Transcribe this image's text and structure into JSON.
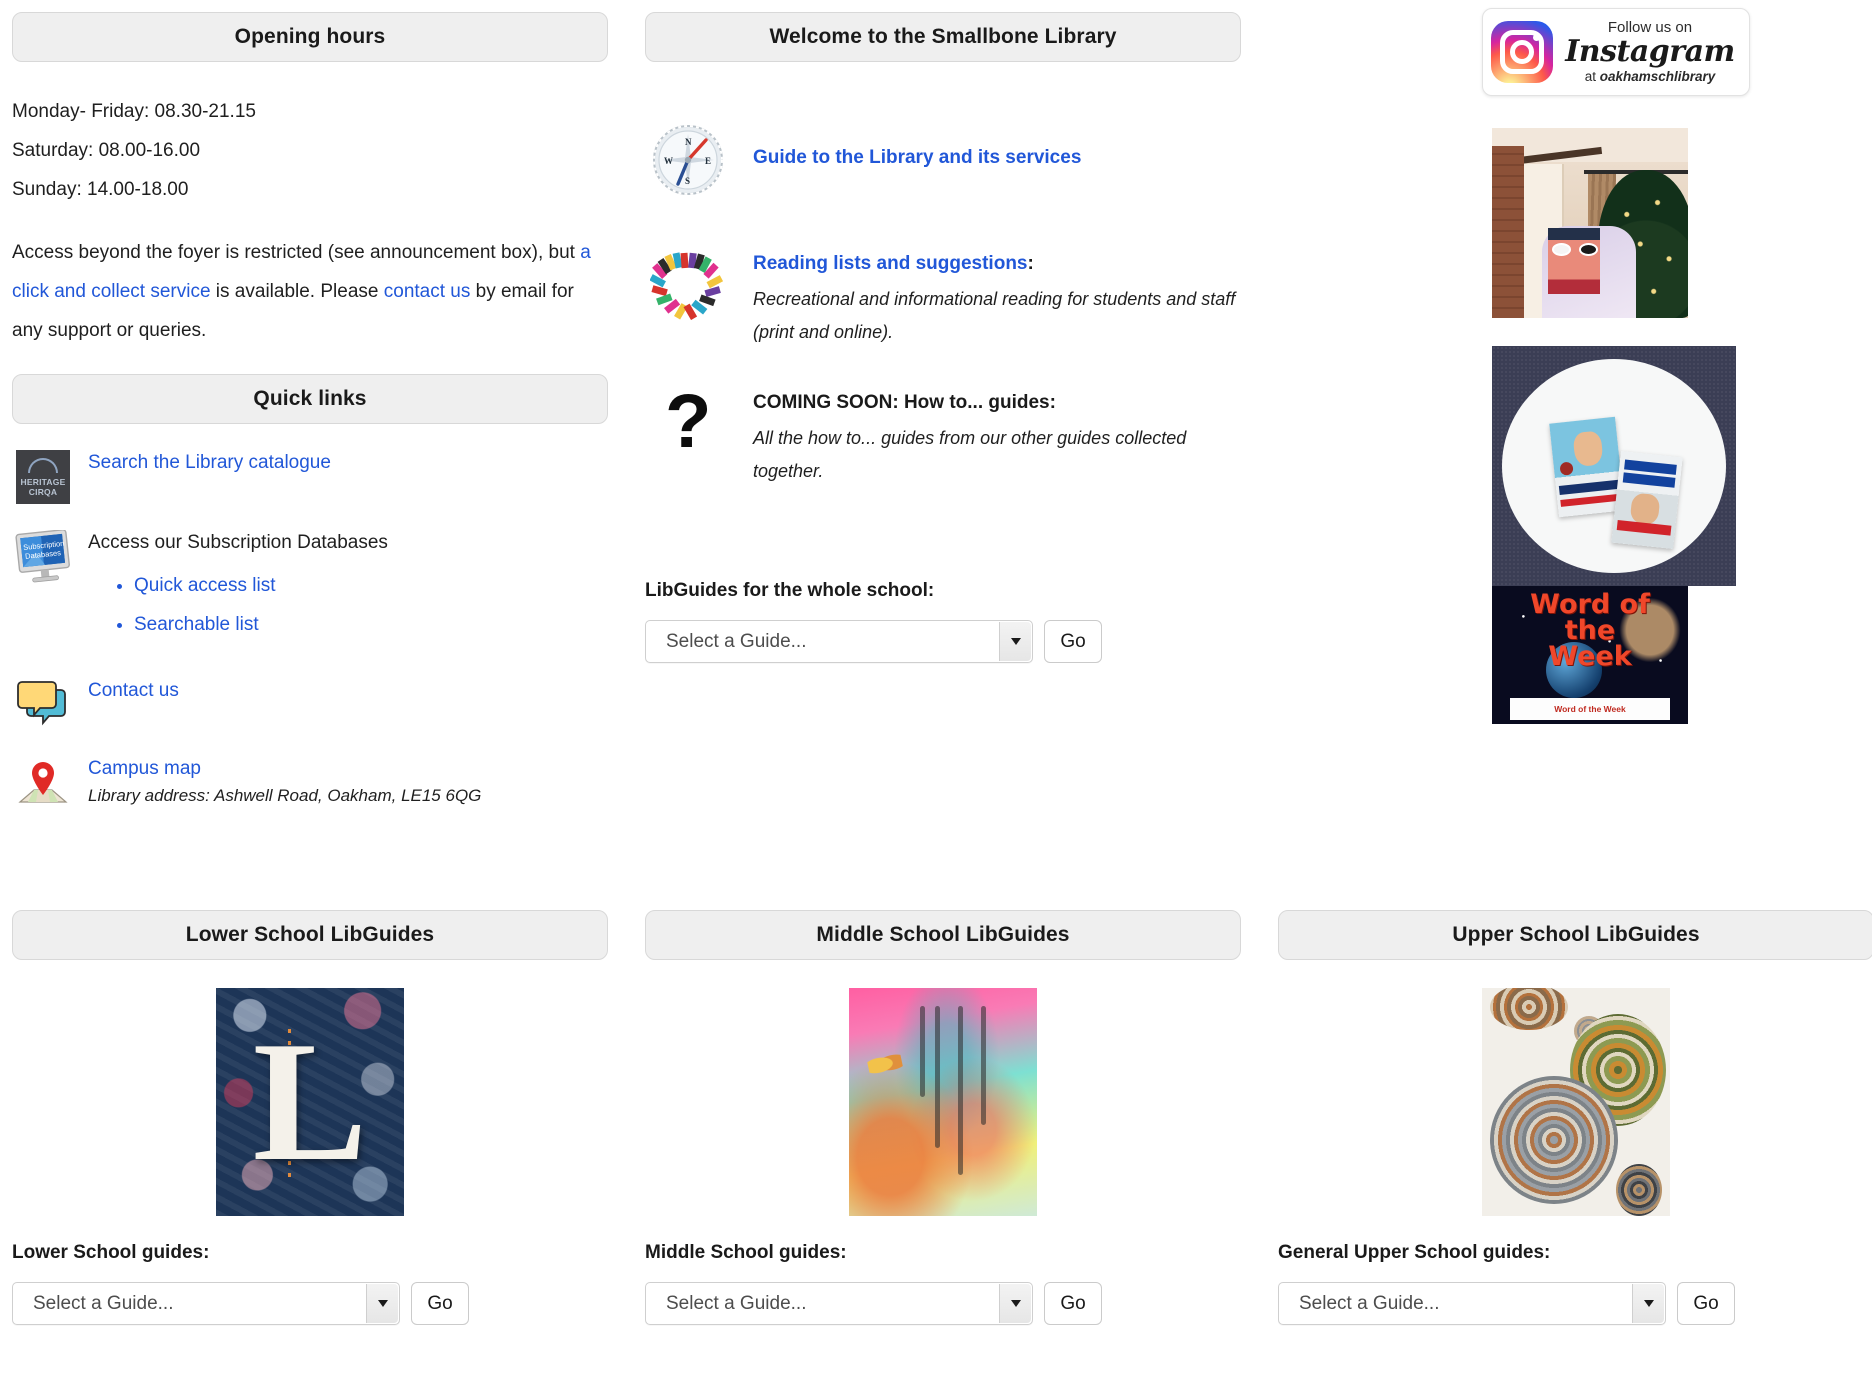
{
  "left": {
    "opening_hours_header": "Opening hours",
    "hours": [
      "Monday- Friday: 08.30-21.15",
      "Saturday:  08.00-16.00",
      "Sunday:  14.00-18.00"
    ],
    "access_text_1": "Access beyond the foyer is restricted (see announcement box), but ",
    "access_link_1": "a click and collect service",
    "access_text_2": " is available. Please ",
    "access_link_2": "contact us",
    "access_text_3": " by email for any support or queries.",
    "quick_links_header": "Quick links",
    "catalogue_link": "Search the Library catalogue",
    "heritage_logo_line1": "HERITAGE",
    "heritage_logo_line2": "CIRQA",
    "databases_label": "Access our Subscription Databases",
    "databases_icon_line1": "Subscription",
    "databases_icon_line2": "Databases",
    "database_sublinks": [
      "Quick access list",
      "Searchable list"
    ],
    "contact_link": "Contact us",
    "campus_map_link": "Campus map",
    "library_address": "Library address: Ashwell Road, Oakham, LE15 6QG"
  },
  "middle": {
    "welcome_header": "Welcome to the Smallbone Library",
    "features": [
      {
        "icon": "compass-icon",
        "title": "Guide to the Library and its services",
        "title_is_link": true,
        "colon": "",
        "desc": ""
      },
      {
        "icon": "book-heart-icon",
        "title": "Reading lists and suggestions",
        "title_is_link": true,
        "colon": ":",
        "desc": "Recreational and informational reading for students and staff (print and online)."
      },
      {
        "icon": "question-mark-icon",
        "title": "COMING SOON: How to... guides:",
        "title_is_link": false,
        "colon": "",
        "desc": "All the how to... guides from our other guides collected together."
      }
    ],
    "select_label": "LibGuides for the whole school:",
    "select_value": "Select a Guide...",
    "go_label": "Go"
  },
  "right": {
    "instagram": {
      "follow_text": "Follow us on",
      "brand": "Instagram",
      "handle_prefix": "at ",
      "handle": "oakhamschlibrary"
    },
    "feed_alt": [
      "Bookface photo with Christmas tree",
      "Stuart Broad cricket books on a white table",
      "Word of the Week poster"
    ],
    "word_of_week_title": "Word of\nthe\nWeek",
    "word_of_week_caption": "Word of the Week"
  },
  "bottom": [
    {
      "header": "Lower School LibGuides",
      "art": "lower-school-collage",
      "art_letter": "L",
      "select_label": "Lower School guides:",
      "select_value": "Select a Guide...",
      "go_label": "Go"
    },
    {
      "header": "Middle School LibGuides",
      "art": "middle-school-watercolour",
      "art_letter": "",
      "select_label": "Middle School guides:",
      "select_value": "Select a Guide...",
      "go_label": "Go"
    },
    {
      "header": "Upper School LibGuides",
      "art": "upper-school-fibre-art",
      "art_letter": "",
      "select_label": "General Upper School guides:",
      "select_value": "Select a Guide...",
      "go_label": "Go"
    }
  ],
  "colors": {
    "link": "#2157d8",
    "header_bg": "#efefef",
    "text": "#1f1f1f"
  }
}
